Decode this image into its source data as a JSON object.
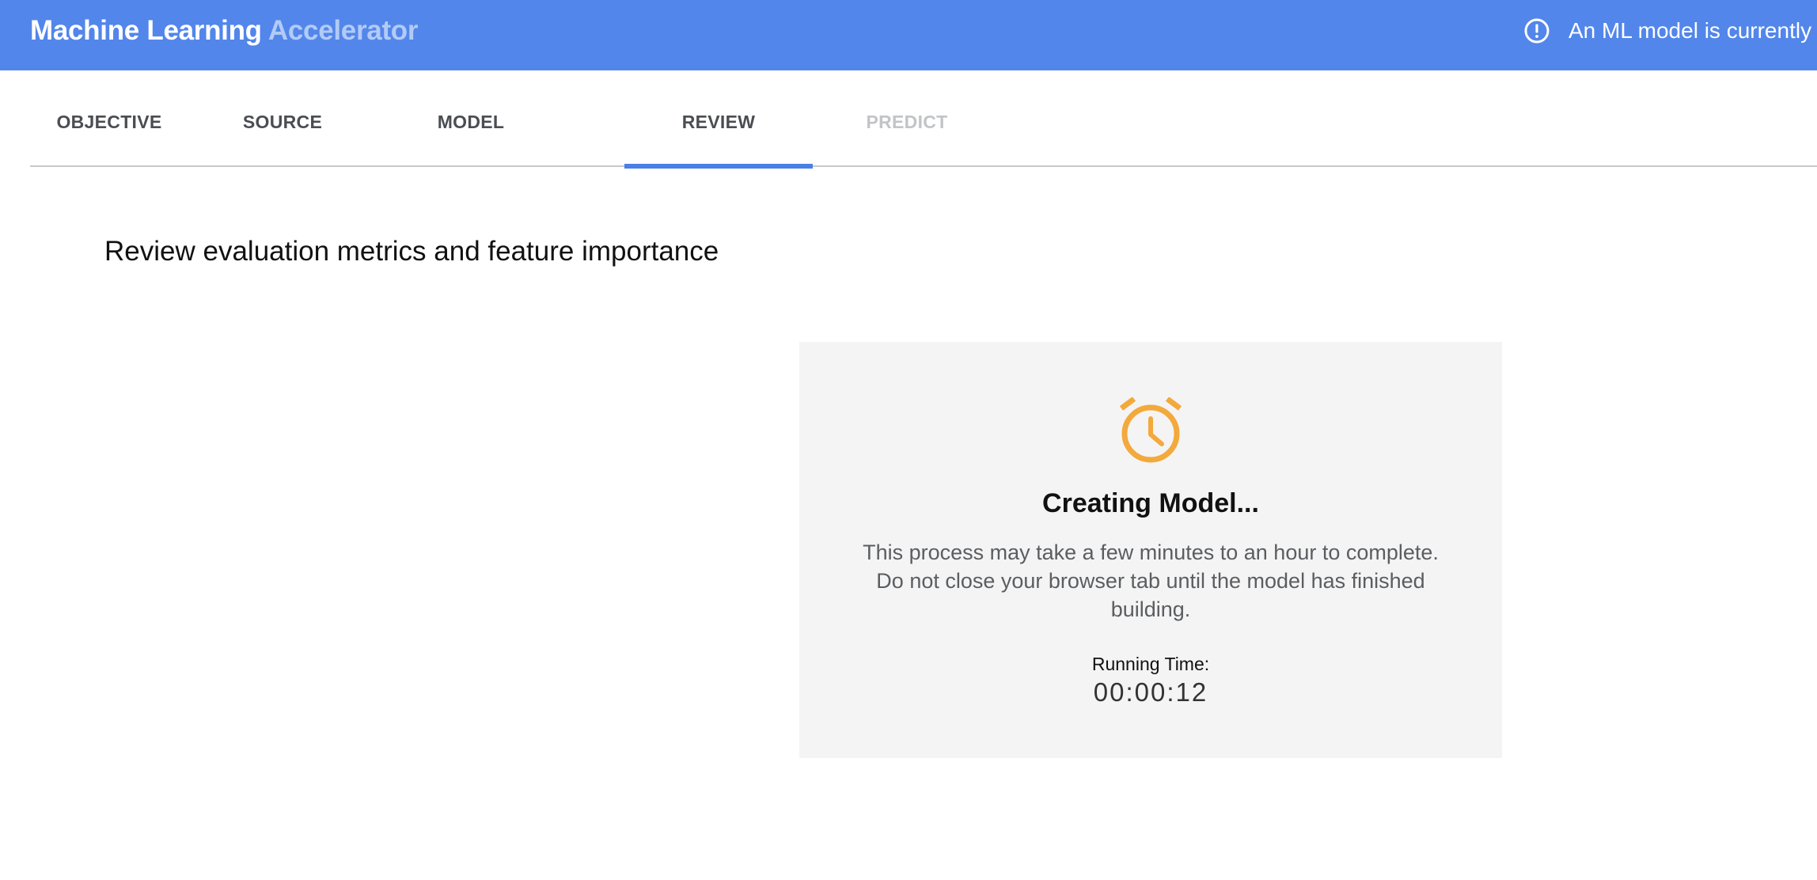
{
  "header": {
    "brand_main": "Machine Learning",
    "brand_accent": "Accelerator",
    "notice_icon": "alert-circle-icon",
    "notice_text": "An ML model is currently training"
  },
  "tabs": [
    {
      "label": "OBJECTIVE",
      "state": "enabled"
    },
    {
      "label": "SOURCE",
      "state": "enabled"
    },
    {
      "label": "MODEL",
      "state": "enabled"
    },
    {
      "label": "REVIEW",
      "state": "active"
    },
    {
      "label": "PREDICT",
      "state": "disabled"
    }
  ],
  "main": {
    "title": "Review evaluation metrics and feature importance"
  },
  "status_card": {
    "icon": "alarm-clock-icon",
    "heading": "Creating Model...",
    "message": "This process may take a few minutes to an hour to complete. Do not close your browser tab until the model has finished building.",
    "running_label": "Running Time:",
    "running_value": "00:00:12"
  },
  "colors": {
    "header_bg": "#5286ea",
    "brand_accent": "#b2cbf6",
    "tab_active_underline": "#4a80e6",
    "alarm_icon": "#f3a93b",
    "card_bg": "#f4f4f4"
  }
}
